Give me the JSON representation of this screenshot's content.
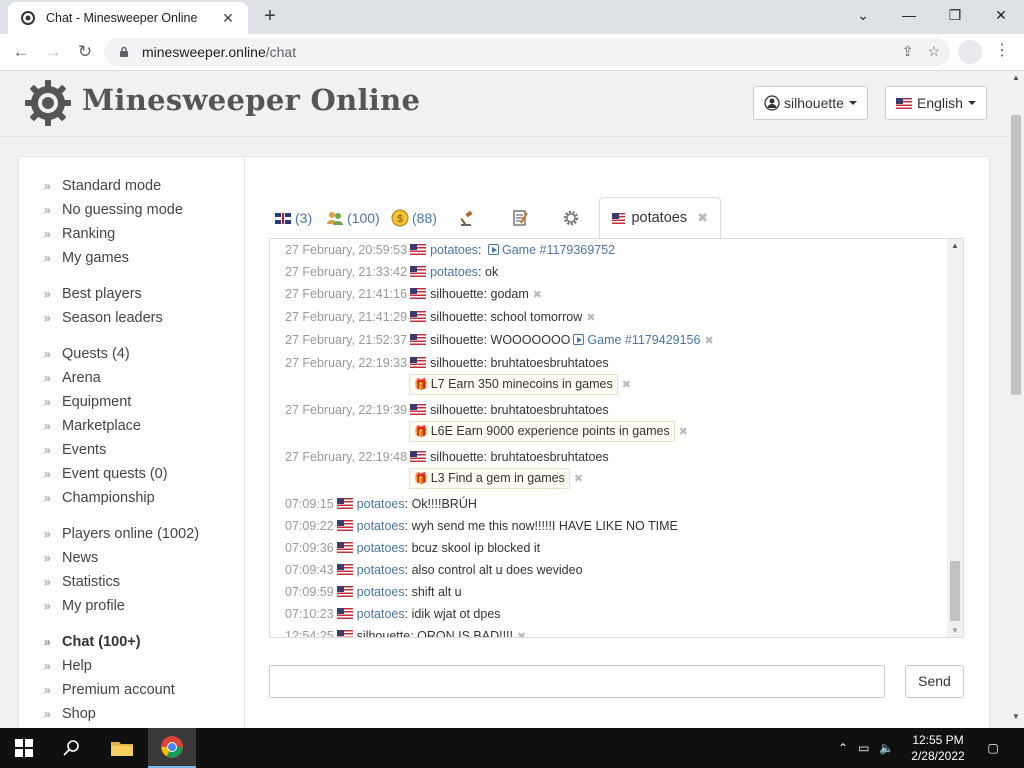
{
  "browser": {
    "tab_title": "Chat - Minesweeper Online",
    "url_host": "minesweeper.online",
    "url_path": "/chat"
  },
  "header": {
    "site_name": "Minesweeper Online",
    "user_menu": "silhouette",
    "language_menu": "English"
  },
  "sidebar": {
    "groups": [
      [
        "Standard mode",
        "No guessing mode",
        "Ranking",
        "My games"
      ],
      [
        "Best players",
        "Season leaders"
      ],
      [
        "Quests (4)",
        "Arena",
        "Equipment",
        "Marketplace",
        "Events",
        "Event quests (0)",
        "Championship"
      ],
      [
        "Players online (1002)",
        "News",
        "Statistics",
        "My profile"
      ],
      [
        "Chat (100+)",
        "Help",
        "Premium account",
        "Shop"
      ]
    ]
  },
  "chat": {
    "tabs": {
      "english_count": "(3)",
      "friends_count": "(100)",
      "coins_count": "(88)",
      "private_tab": "potatoes"
    },
    "messages": [
      {
        "ts": "27 February, 20:59:53",
        "user": "potatoes",
        "linked": true,
        "text": ": ",
        "game": "Game #1179369752",
        "del": false
      },
      {
        "ts": "27 February, 21:33:42",
        "user": "potatoes",
        "linked": true,
        "text": ": ok",
        "game": "",
        "del": false
      },
      {
        "ts": "27 February, 21:41:16",
        "user": "silhouette",
        "linked": false,
        "text": ": godam",
        "game": "",
        "del": true
      },
      {
        "ts": "27 February, 21:41:29",
        "user": "silhouette",
        "linked": false,
        "text": ": school tomorrow",
        "game": "",
        "del": true
      },
      {
        "ts": "27 February, 21:52:37",
        "user": "silhouette",
        "linked": false,
        "text": ": WOOOOOOO",
        "game": "Game #1179429156",
        "del": true
      },
      {
        "ts": "27 February, 22:19:33",
        "user": "silhouette",
        "linked": false,
        "text": ": bruhtatoesbruhtatoes",
        "game": "",
        "del": false,
        "quest": "L7 Earn 350 minecoins in games"
      },
      {
        "ts": "27 February, 22:19:39",
        "user": "silhouette",
        "linked": false,
        "text": ": bruhtatoesbruhtatoes",
        "game": "",
        "del": false,
        "quest": "L6E Earn 9000 experience points in games"
      },
      {
        "ts": "27 February, 22:19:48",
        "user": "silhouette",
        "linked": false,
        "text": ": bruhtatoesbruhtatoes",
        "game": "",
        "del": false,
        "quest": "L3 Find a gem in games"
      },
      {
        "ts": "07:09:15",
        "user": "potatoes",
        "linked": true,
        "text": ": Ok!!!!BRÚH",
        "game": "",
        "del": false
      },
      {
        "ts": "07:09:22",
        "user": "potatoes",
        "linked": true,
        "text": ": wyh send me this now!!!!!I HAVE LIKE NO TIME",
        "game": "",
        "del": false
      },
      {
        "ts": "07:09:36",
        "user": "potatoes",
        "linked": true,
        "text": ": bcuz skool ip blocked it",
        "game": "",
        "del": false
      },
      {
        "ts": "07:09:43",
        "user": "potatoes",
        "linked": true,
        "text": ": also control alt u does wevideo",
        "game": "",
        "del": false
      },
      {
        "ts": "07:09:59",
        "user": "potatoes",
        "linked": true,
        "text": ": shift alt u",
        "game": "",
        "del": false
      },
      {
        "ts": "07:10:23",
        "user": "potatoes",
        "linked": true,
        "text": ": idik wjat ot dpes",
        "game": "",
        "del": false
      },
      {
        "ts": "12:54:25",
        "user": "silhouette",
        "linked": false,
        "text": ": ORON IS BAD!!!!",
        "game": "",
        "del": true
      }
    ],
    "input_value": "",
    "send_label": "Send"
  },
  "taskbar": {
    "time": "12:55 PM",
    "date": "2/28/2022"
  },
  "colors": {
    "link": "#4a76a8",
    "timestamp": "#999999",
    "page_bg": "#f0f1f1"
  }
}
